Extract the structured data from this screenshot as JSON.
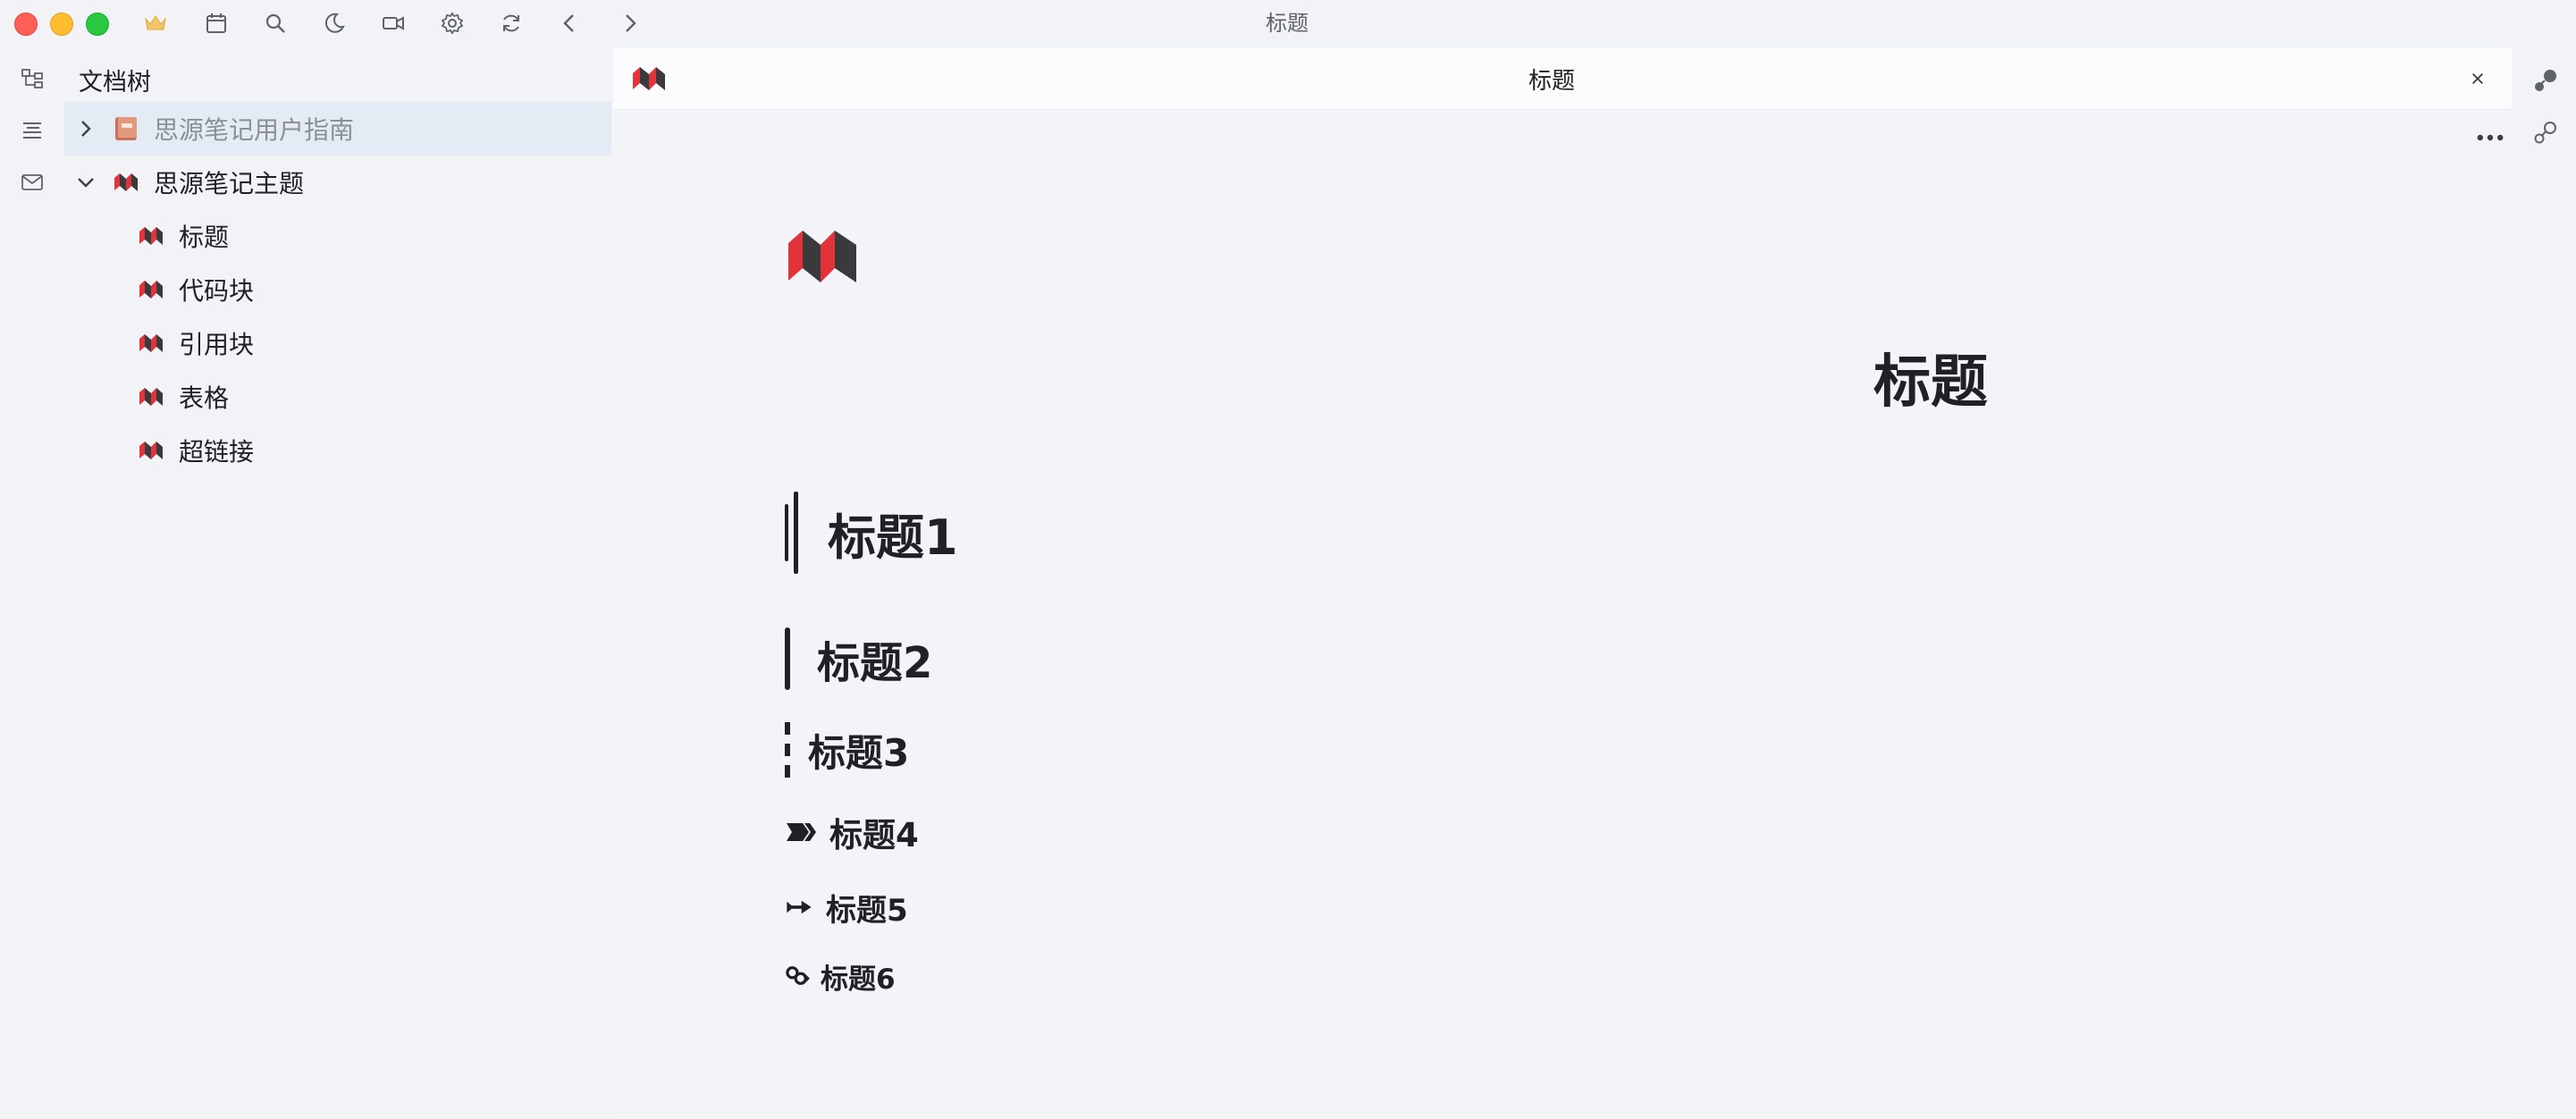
{
  "window": {
    "title": "标题"
  },
  "toolbar": {
    "icons": [
      "crown-icon",
      "calendar-icon",
      "search-icon",
      "moon-icon",
      "video-icon",
      "gear-icon",
      "sync-icon",
      "back-icon",
      "forward-icon"
    ]
  },
  "dock": {
    "icons": [
      "file-tree-icon",
      "outline-icon",
      "inbox-icon"
    ]
  },
  "file_tree": {
    "header": "文档树",
    "notebooks": [
      {
        "label": "思源笔记用户指南",
        "expanded": false,
        "icon": "book-icon"
      },
      {
        "label": "思源笔记主题",
        "expanded": true,
        "icon": "theme-logo-icon"
      }
    ],
    "docs": [
      {
        "label": "标题"
      },
      {
        "label": "代码块"
      },
      {
        "label": "引用块"
      },
      {
        "label": "表格"
      },
      {
        "label": "超链接"
      }
    ]
  },
  "editor": {
    "tab_title": "标题",
    "doc_title": "标题",
    "headings": [
      {
        "level": 1,
        "text": "标题1"
      },
      {
        "level": 2,
        "text": "标题2"
      },
      {
        "level": 3,
        "text": "标题3"
      },
      {
        "level": 4,
        "text": "标题4"
      },
      {
        "level": 5,
        "text": "标题5"
      },
      {
        "level": 6,
        "text": "标题6"
      }
    ]
  },
  "right_dock": {
    "icons": [
      "graph-icon",
      "global-graph-icon"
    ]
  },
  "colors": {
    "background": "#f2f3f7",
    "selected_row": "#e4ebf5",
    "logo_red": "#e0333c",
    "logo_dark": "#3a3a3c",
    "text": "#202124"
  }
}
